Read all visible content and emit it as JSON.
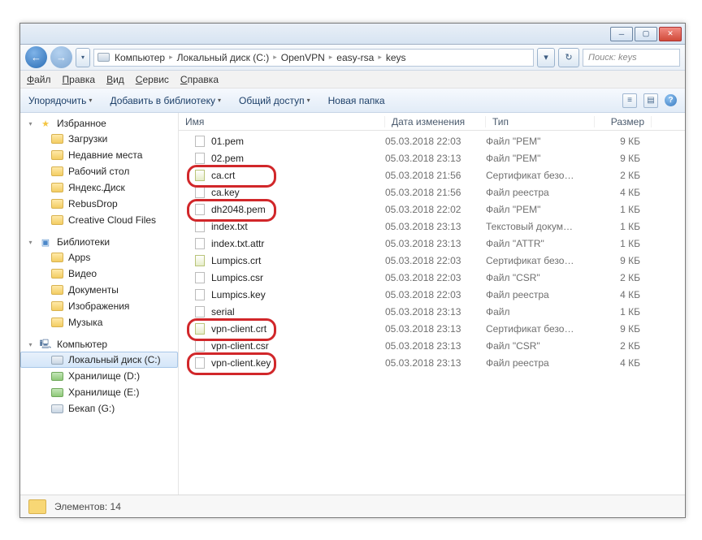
{
  "titlebar": {
    "min": "─",
    "max": "▢",
    "close": "✕"
  },
  "nav": {
    "back": "←",
    "fwd": "→",
    "up": "▲",
    "crumbs": [
      "Компьютер",
      "Локальный диск (C:)",
      "OpenVPN",
      "easy-rsa",
      "keys"
    ],
    "refresh": "↻",
    "search_placeholder": "Поиск: keys"
  },
  "menubar": [
    "Файл",
    "Правка",
    "Вид",
    "Сервис",
    "Справка"
  ],
  "toolbar": {
    "organize": "Упорядочить",
    "addlib": "Добавить в библиотеку",
    "share": "Общий доступ",
    "newfolder": "Новая папка",
    "views": "≡",
    "preview": "▤",
    "help": "?"
  },
  "sidebar": {
    "favorites": {
      "label": "Избранное",
      "items": [
        {
          "icon": "dl",
          "label": "Загрузки"
        },
        {
          "icon": "recent",
          "label": "Недавние места"
        },
        {
          "icon": "desk",
          "label": "Рабочий стол"
        },
        {
          "icon": "ya",
          "label": "Яндекс.Диск"
        },
        {
          "icon": "rb",
          "label": "RebusDrop"
        },
        {
          "icon": "cc",
          "label": "Creative Cloud Files"
        }
      ]
    },
    "libraries": {
      "label": "Библиотеки",
      "items": [
        {
          "icon": "folder",
          "label": "Apps"
        },
        {
          "icon": "vid",
          "label": "Видео"
        },
        {
          "icon": "doc",
          "label": "Документы"
        },
        {
          "icon": "img",
          "label": "Изображения"
        },
        {
          "icon": "mus",
          "label": "Музыка"
        }
      ]
    },
    "computer": {
      "label": "Компьютер",
      "items": [
        {
          "icon": "drive",
          "label": "Локальный диск (C:)",
          "selected": true
        },
        {
          "icon": "green",
          "label": "Хранилище (D:)"
        },
        {
          "icon": "green",
          "label": "Хранилище (E:)"
        },
        {
          "icon": "drive",
          "label": "Бекап (G:)"
        }
      ]
    }
  },
  "columns": {
    "name": "Имя",
    "date": "Дата изменения",
    "type": "Тип",
    "size": "Размер"
  },
  "files": [
    {
      "name": "01.pem",
      "date": "05.03.2018 22:03",
      "type": "Файл \"PEM\"",
      "size": "9 КБ",
      "icon": "file",
      "circled": false
    },
    {
      "name": "02.pem",
      "date": "05.03.2018 23:13",
      "type": "Файл \"PEM\"",
      "size": "9 КБ",
      "icon": "file",
      "circled": false
    },
    {
      "name": "ca.crt",
      "date": "05.03.2018 21:56",
      "type": "Сертификат безо…",
      "size": "2 КБ",
      "icon": "cert",
      "circled": true
    },
    {
      "name": "ca.key",
      "date": "05.03.2018 21:56",
      "type": "Файл реестра",
      "size": "4 КБ",
      "icon": "key",
      "circled": false
    },
    {
      "name": "dh2048.pem",
      "date": "05.03.2018 22:02",
      "type": "Файл \"PEM\"",
      "size": "1 КБ",
      "icon": "file",
      "circled": true
    },
    {
      "name": "index.txt",
      "date": "05.03.2018 23:13",
      "type": "Текстовый докум…",
      "size": "1 КБ",
      "icon": "txt",
      "circled": false
    },
    {
      "name": "index.txt.attr",
      "date": "05.03.2018 23:13",
      "type": "Файл \"ATTR\"",
      "size": "1 КБ",
      "icon": "file",
      "circled": false
    },
    {
      "name": "Lumpics.crt",
      "date": "05.03.2018 22:03",
      "type": "Сертификат безо…",
      "size": "9 КБ",
      "icon": "cert",
      "circled": false
    },
    {
      "name": "Lumpics.csr",
      "date": "05.03.2018 22:03",
      "type": "Файл \"CSR\"",
      "size": "2 КБ",
      "icon": "file",
      "circled": false
    },
    {
      "name": "Lumpics.key",
      "date": "05.03.2018 22:03",
      "type": "Файл реестра",
      "size": "4 КБ",
      "icon": "key",
      "circled": false
    },
    {
      "name": "serial",
      "date": "05.03.2018 23:13",
      "type": "Файл",
      "size": "1 КБ",
      "icon": "file",
      "circled": false
    },
    {
      "name": "vpn-client.crt",
      "date": "05.03.2018 23:13",
      "type": "Сертификат безо…",
      "size": "9 КБ",
      "icon": "cert",
      "circled": true
    },
    {
      "name": "vpn-client.csr",
      "date": "05.03.2018 23:13",
      "type": "Файл \"CSR\"",
      "size": "2 КБ",
      "icon": "file",
      "circled": false
    },
    {
      "name": "vpn-client.key",
      "date": "05.03.2018 23:13",
      "type": "Файл реестра",
      "size": "4 КБ",
      "icon": "key",
      "circled": true
    }
  ],
  "statusbar": {
    "count": "Элементов: 14"
  }
}
